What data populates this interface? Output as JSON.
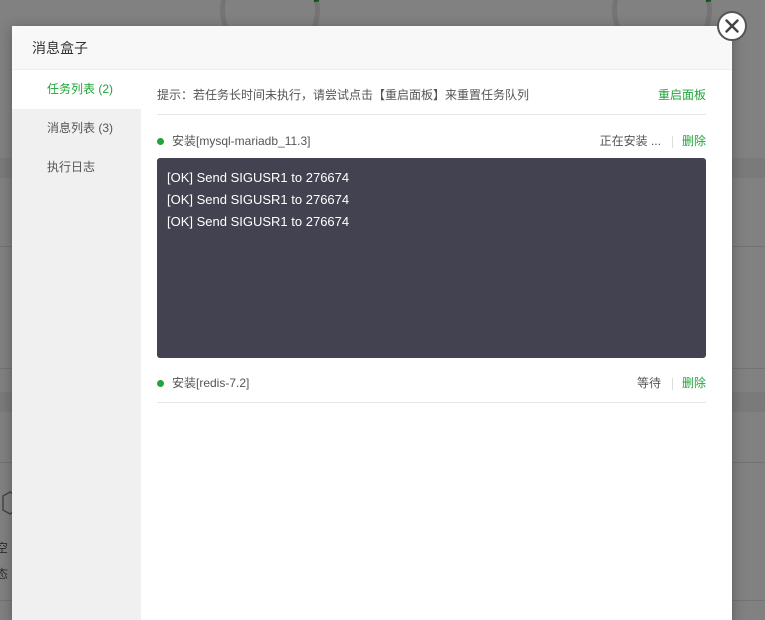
{
  "modal": {
    "title": "消息盒子"
  },
  "sidebar": {
    "items": [
      {
        "label": "任务列表 (2)",
        "active": true
      },
      {
        "label": "消息列表 (3)",
        "active": false
      },
      {
        "label": "执行日志",
        "active": false
      }
    ]
  },
  "tip": {
    "text": "提示：若任务长时间未执行，请尝试点击【重启面板】来重置任务队列",
    "restart_link": "重启面板"
  },
  "tasks": [
    {
      "name": "安装[mysql-mariadb_11.3]",
      "status": "正在安装 ...",
      "delete_label": "删除",
      "log": [
        "[OK] Send SIGUSR1 to 276674",
        "[OK] Send SIGUSR1 to 276674",
        "[OK] Send SIGUSR1 to 276674"
      ]
    },
    {
      "name": "安装[redis-7.2]",
      "status": "等待",
      "delete_label": "删除"
    }
  ],
  "background": {
    "text_1": "空",
    "text_2": "态"
  },
  "colors": {
    "accent": "#20a53a",
    "log_bg": "#424250",
    "sidebar_bg": "#f0f0f0"
  },
  "icons": {
    "close": "close-icon",
    "status_dot": "status-dot-icon"
  }
}
